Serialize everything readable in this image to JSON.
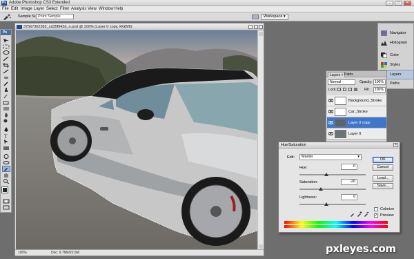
{
  "window": {
    "title": "Adobe Photoshop CS3 Extended",
    "controls": [
      "_",
      "□",
      "✕"
    ]
  },
  "menu": [
    "File",
    "Edit",
    "Image",
    "Layer",
    "Select",
    "Filter",
    "Analysis",
    "View",
    "Window",
    "Help"
  ],
  "options_bar": {
    "sample_size_label": "Sample Size:",
    "sample_size_value": "Point Sample",
    "workspace_label": "Workspace ▾"
  },
  "toolbox": {
    "header": "Ps"
  },
  "document": {
    "title": "37567362382_cd35f942d_o.psd @ 100% (Layer 0 copy, RGB/8)",
    "zoom": "100%",
    "doc_info": "Doc: 9.76M/22.6M"
  },
  "dock": [
    {
      "label": "Navigator",
      "icon": "navigator-icon"
    },
    {
      "label": "Histogram",
      "icon": "histogram-icon"
    },
    {
      "label": "Color",
      "icon": "color-icon"
    },
    {
      "label": "Styles",
      "icon": "styles-icon"
    },
    {
      "label": "Layers",
      "icon": "layers-icon"
    },
    {
      "label": "Paths",
      "icon": "paths-icon"
    }
  ],
  "layers_panel": {
    "tabs": [
      "Layers ×",
      "Paths"
    ],
    "blend_mode": "Normal",
    "opacity_label": "Opacity:",
    "opacity_value": "100%",
    "lock_label": "Lock:",
    "fill_label": "Fill:",
    "fill_value": "100%",
    "layers": [
      {
        "name": "Background_Stroke",
        "selected": false
      },
      {
        "name": "Car_Stroke",
        "selected": false
      },
      {
        "name": "Layer 0 copy",
        "selected": true
      },
      {
        "name": "Layer 0",
        "selected": false
      }
    ]
  },
  "hue_saturation": {
    "title": "Hue/Saturation",
    "edit_label": "Edit:",
    "edit_value": "Master",
    "hue_label": "Hue:",
    "hue_value": "0",
    "saturation_label": "Saturation:",
    "saturation_value": "-20",
    "lightness_label": "Lightness:",
    "lightness_value": "0",
    "buttons": [
      "OK",
      "Cancel",
      "Load...",
      "Save..."
    ],
    "colorize_label": "Colorize",
    "colorize_checked": false,
    "preview_label": "Preview",
    "preview_checked": true
  },
  "watermark": "pxleyes.com"
}
